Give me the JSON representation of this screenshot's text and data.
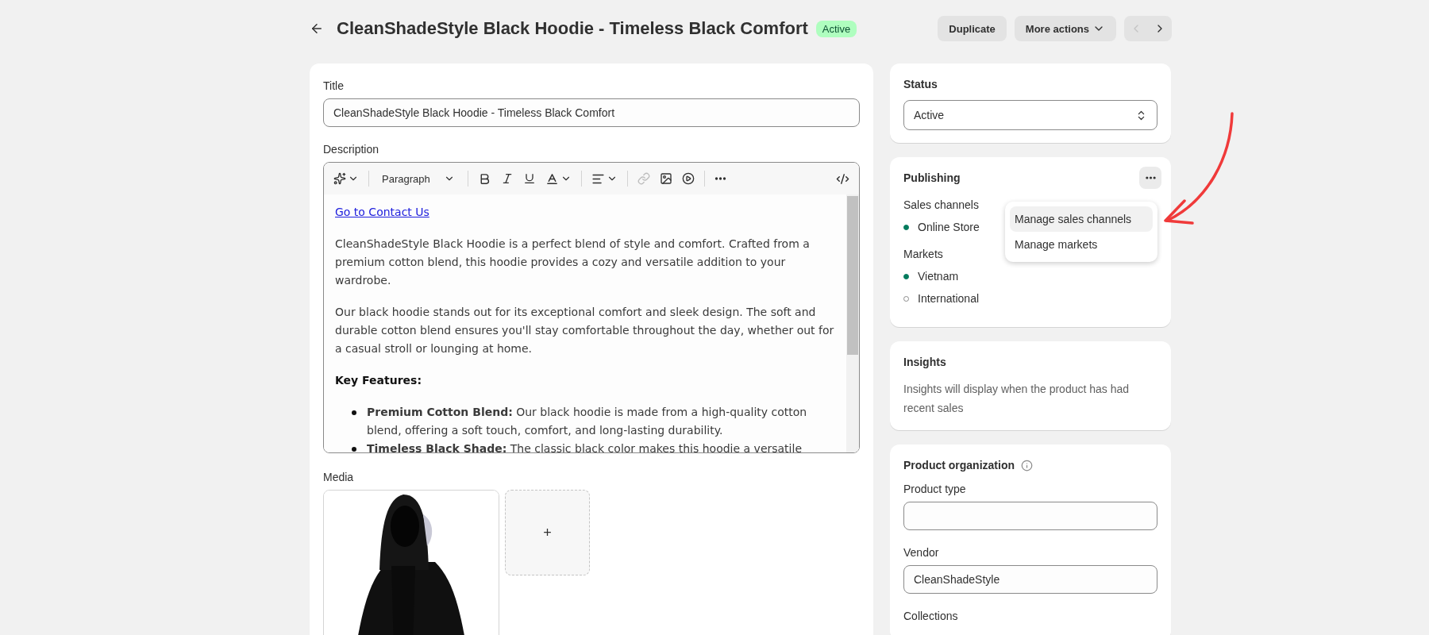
{
  "header": {
    "title": "CleanShadeStyle Black Hoodie - Timeless Black Comfort",
    "badge": "Active",
    "buttons": [
      {
        "label": "Duplicate",
        "kind": "plain"
      },
      {
        "label": "More actions",
        "kind": "menu"
      }
    ],
    "pager": {
      "prev_disabled": true,
      "next_disabled": false
    }
  },
  "product": {
    "title_field": {
      "label": "Title",
      "value": "CleanShadeStyle Black Hoodie - Timeless Black Comfort"
    },
    "description": {
      "label": "Description",
      "paragraph_style": "Paragraph",
      "link": "Go to Contact Us",
      "paragraphs": [
        "CleanShadeStyle Black Hoodie is a perfect blend of style and comfort. Crafted from a premium cotton blend, this hoodie provides a cozy and versatile addition to your wardrobe.",
        "Our black hoodie stands out for its exceptional comfort and sleek design. The soft and durable cotton blend ensures you'll stay comfortable throughout the day, whether out for a casual stroll or lounging at home."
      ],
      "heading": "Key Features:",
      "bullets": [
        "**Premium Cotton Blend:** Our black hoodie is made from a high-quality cotton blend, offering a soft touch, comfort, and long-lasting durability.",
        "**Timeless Black Shade:** The classic black color makes this hoodie a versatile"
      ]
    },
    "media": {
      "label": "Media",
      "add": "+"
    }
  },
  "sidebar": {
    "status": {
      "label": "Status",
      "value": "Active"
    },
    "publishing": {
      "title": "Publishing",
      "sales_channels": {
        "label": "Sales channels",
        "items": [
          {
            "name": "Online Store",
            "on": true
          }
        ]
      },
      "markets": {
        "label": "Markets",
        "items": [
          {
            "name": "Vietnam",
            "on": true
          },
          {
            "name": "International",
            "on": false
          }
        ]
      },
      "menu": [
        {
          "label": "Manage sales channels",
          "selected": true
        },
        {
          "label": "Manage markets",
          "selected": false
        }
      ]
    },
    "insights": {
      "title": "Insights",
      "text": "Insights will display when the product has had recent sales"
    },
    "organization": {
      "title": "Product organization",
      "fields": [
        {
          "label": "Product type",
          "kind": "input"
        },
        {
          "label": "Vendor",
          "kind": "input",
          "value": "CleanShadeStyle"
        },
        {
          "label": "Collections",
          "kind": "label"
        }
      ]
    }
  }
}
